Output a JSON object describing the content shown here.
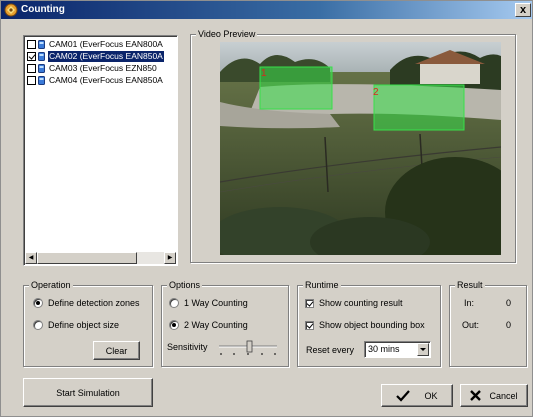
{
  "window": {
    "title": "Counting",
    "close_glyph": "x"
  },
  "camera_list": {
    "items": [
      {
        "label": "CAM01 (EverFocus EAN800A",
        "checked": false,
        "selected": false
      },
      {
        "label": "CAM02 (EverFocus EAN850A",
        "checked": true,
        "selected": true
      },
      {
        "label": "CAM03 (EverFocus EZN850",
        "checked": false,
        "selected": false
      },
      {
        "label": "CAM04 (EverFocus EAN850A",
        "checked": false,
        "selected": false
      }
    ],
    "icon": "camera-icon"
  },
  "video_preview": {
    "label": "Video Preview",
    "zones": [
      {
        "id": "1"
      },
      {
        "id": "2"
      }
    ],
    "zone_color": "#38e04a"
  },
  "operation": {
    "label": "Operation",
    "define_zones": "Define detection zones",
    "define_size": "Define object size",
    "clear": "Clear",
    "selected": "define_zones"
  },
  "options": {
    "label": "Options",
    "one_way": "1 Way Counting",
    "two_way": "2 Way Counting",
    "selected": "two_way",
    "sensitivity_label": "Sensitivity"
  },
  "runtime": {
    "label": "Runtime",
    "show_result": "Show counting result",
    "show_box": "Show object bounding box",
    "reset_label": "Reset every",
    "reset_value": "30 mins"
  },
  "result": {
    "label": "Result",
    "in_label": "In:",
    "in_value": "0",
    "out_label": "Out:",
    "out_value": "0"
  },
  "buttons": {
    "start_simulation": "Start Simulation",
    "ok": "OK",
    "cancel": "Cancel"
  },
  "colors": {
    "title_bar": "#0a246a",
    "dialog_bg": "#d4d0c8",
    "selection": "#0a246a"
  }
}
